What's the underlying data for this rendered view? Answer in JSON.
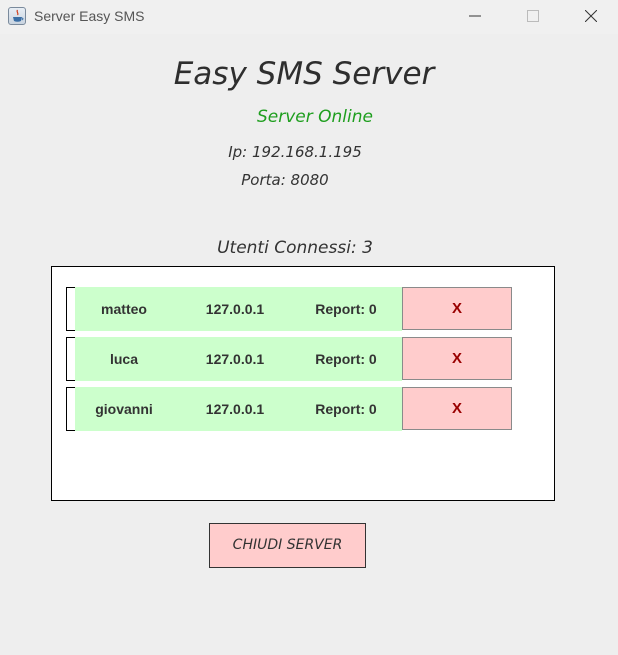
{
  "window": {
    "title": "Server Easy SMS",
    "controls": [
      "minimize-icon",
      "maximize-icon",
      "close-icon"
    ]
  },
  "header": {
    "title": "Easy SMS Server",
    "status": "Server Online",
    "ip": "Ip: 192.168.1.195",
    "port": "Porta: 8080"
  },
  "users": {
    "title": "Utenti Connessi: 3",
    "rows": [
      {
        "name": "matteo",
        "ip": "127.0.0.1",
        "report": "Report: 0",
        "kick": "X"
      },
      {
        "name": "luca",
        "ip": "127.0.0.1",
        "report": "Report: 0",
        "kick": "X"
      },
      {
        "name": "giovanni",
        "ip": "127.0.0.1",
        "report": "Report: 0",
        "kick": "X"
      }
    ]
  },
  "actions": {
    "close_server": "CHIUDI SERVER"
  },
  "colors": {
    "status_online": "#1e9e1e",
    "row_background": "#ccffcc",
    "kick_button": "#ffcccc",
    "kick_text": "#990000"
  }
}
